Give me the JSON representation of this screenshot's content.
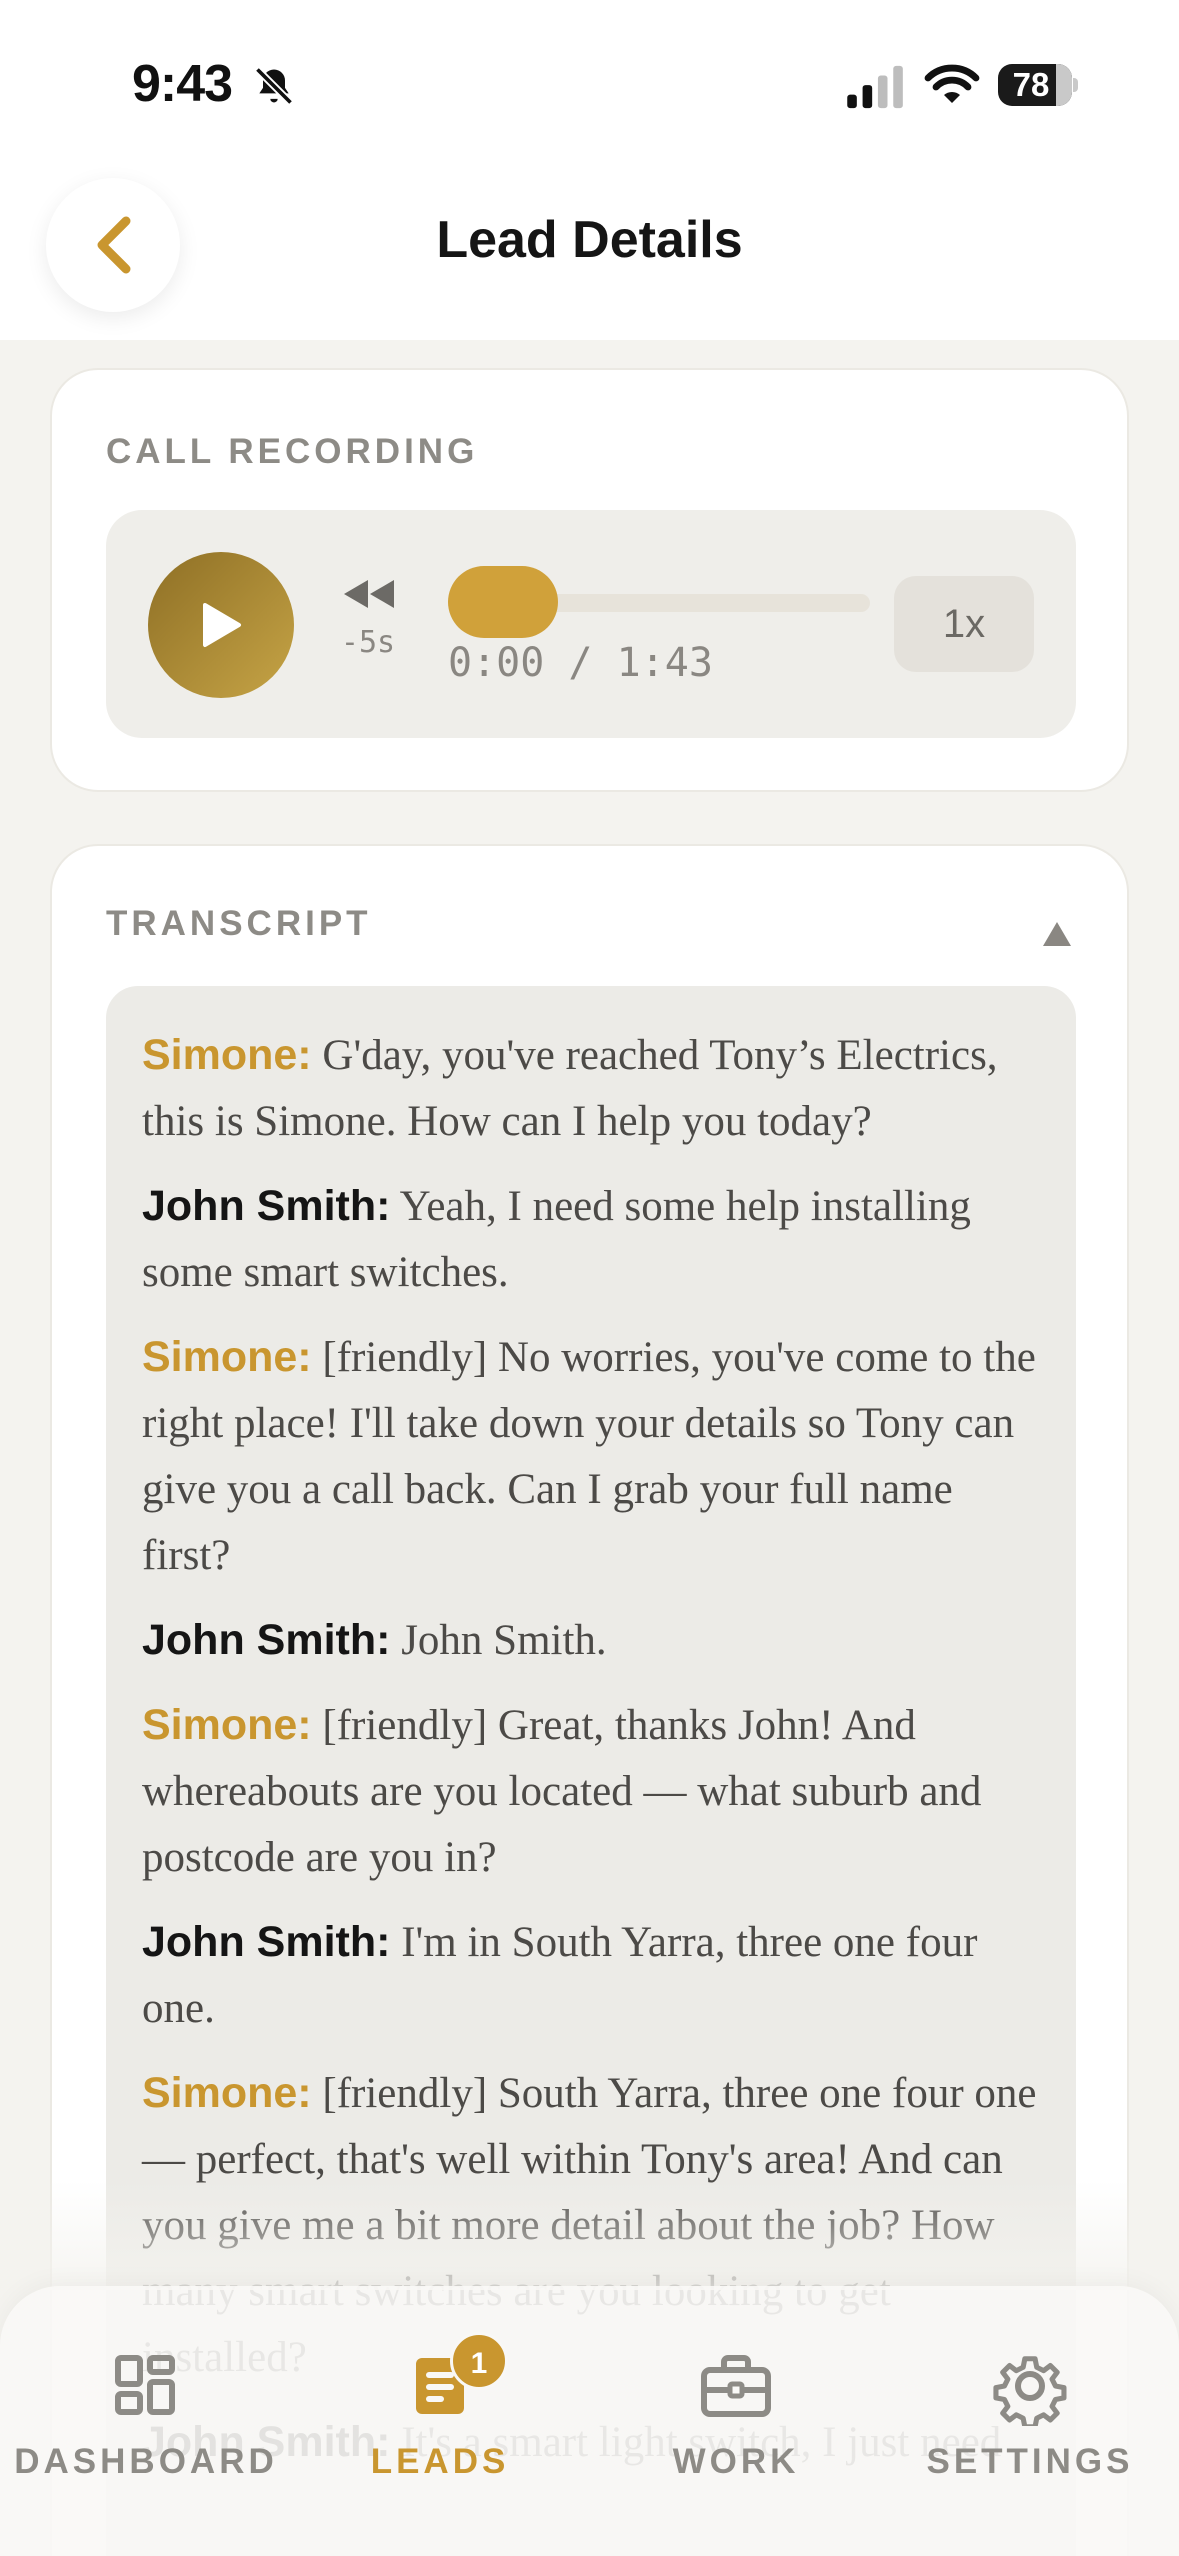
{
  "status_bar": {
    "time": "9:43",
    "battery": "78"
  },
  "header": {
    "title": "Lead Details"
  },
  "recording": {
    "label": "CALL RECORDING",
    "rewind_label": "-5s",
    "time_display": "0:00 / 1:43",
    "progress": 0,
    "speed_label": "1x"
  },
  "transcript": {
    "label": "TRANSCRIPT",
    "messages": [
      {
        "speaker": "Simone:",
        "text": "G'day, you've reached Tony’s Electrics, this is Simone. How can I help you today?"
      },
      {
        "speaker": "John Smith:",
        "text": "Yeah, I need some help installing some smart switches."
      },
      {
        "speaker": "Simone:",
        "text": "[friendly] No worries, you've come to the right place! I'll take down your details so Tony can give you a call back. Can I grab your full name first?"
      },
      {
        "speaker": "John Smith:",
        "text": "John Smith."
      },
      {
        "speaker": "Simone:",
        "text": "[friendly] Great, thanks John! And whereabouts are you located — what suburb and postcode are you in?"
      },
      {
        "speaker": "John Smith:",
        "text": "I'm in South Yarra, three one four one."
      },
      {
        "speaker": "Simone:",
        "text": "[friendly] South Yarra, three one four one — perfect, that's well within Tony's area! And can you give me a bit more detail about the job? How many smart switches are you looking to get installed?"
      },
      {
        "speaker": "John Smith:",
        "text": "It's a smart light switch, I just need"
      }
    ]
  },
  "tabs": [
    {
      "label": "DASHBOARD",
      "icon": "dashboard-icon",
      "active": false
    },
    {
      "label": "LEADS",
      "icon": "leads-icon",
      "active": true,
      "badge": "1"
    },
    {
      "label": "WORK",
      "icon": "toolbox-icon",
      "active": false
    },
    {
      "label": "SETTINGS",
      "icon": "gear-icon",
      "active": false
    }
  ],
  "colors": {
    "accent": "#c9962f",
    "play_gradient_start": "#8e6f25",
    "play_gradient_end": "#c6a446",
    "muted": "#8d8b86",
    "background": "#f4f3ef"
  }
}
